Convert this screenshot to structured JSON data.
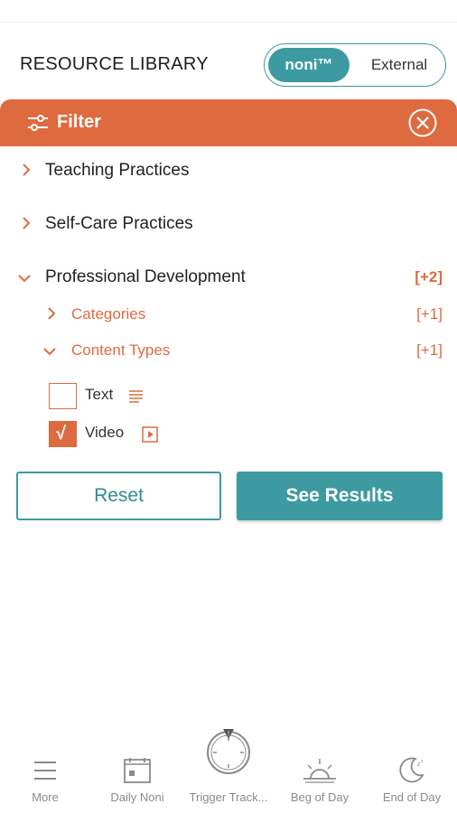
{
  "header": {
    "title": "RESOURCE LIBRARY",
    "toggle_active": "noni™",
    "toggle_inactive": "External"
  },
  "filter": {
    "title": "Filter",
    "close_icon": "close-circle-icon",
    "items": [
      {
        "label": "Teaching Practices",
        "expanded": false
      },
      {
        "label": "Self-Care Practices",
        "expanded": false
      },
      {
        "label": "Professional Development",
        "expanded": true,
        "count": "[+2]"
      }
    ],
    "sub_items": [
      {
        "label": "Categories",
        "expanded": false,
        "count": "[+1]"
      },
      {
        "label": "Content Types",
        "expanded": true,
        "count": "[+1]"
      }
    ],
    "options": [
      {
        "label": "Text",
        "checked": false,
        "icon": "text-lines-icon"
      },
      {
        "label": "Video",
        "checked": true,
        "icon": "video-play-icon"
      }
    ],
    "checkmark": "√"
  },
  "actions": {
    "reset": "Reset",
    "see_results": "See Results"
  },
  "tabbar": {
    "items": [
      {
        "label": "More",
        "icon": "menu-icon"
      },
      {
        "label": "Daily Noni",
        "icon": "calendar-icon"
      },
      {
        "label": "Trigger Track...",
        "icon": "alarm-clock-icon"
      },
      {
        "label": "Beg of Day",
        "icon": "sunrise-icon"
      },
      {
        "label": "End of Day",
        "icon": "moon-icon"
      }
    ]
  },
  "colors": {
    "accent_orange": "#de6a3f",
    "accent_teal": "#3d9aa0",
    "muted_gray": "#8a8a8a"
  }
}
